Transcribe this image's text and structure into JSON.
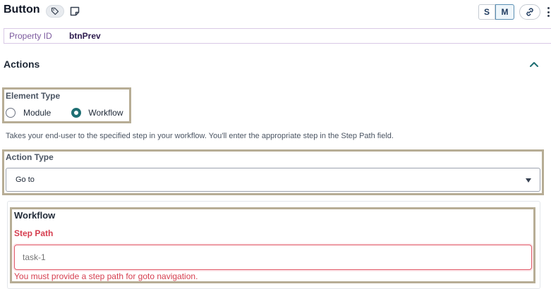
{
  "header": {
    "title": "Button",
    "size_small": "S",
    "size_medium": "M"
  },
  "property": {
    "label": "Property ID",
    "value": "btnPrev"
  },
  "actions": {
    "title": "Actions"
  },
  "element_type": {
    "label": "Element Type",
    "options": [
      {
        "label": "Module",
        "checked": false
      },
      {
        "label": "Workflow",
        "checked": true
      }
    ],
    "help": "Takes your end-user to the specified step in your workflow. You'll enter the appropriate step in the Step Path field."
  },
  "action_type": {
    "label": "Action Type",
    "selected": "Go to"
  },
  "workflow": {
    "title": "Workflow",
    "step_path_label": "Step Path",
    "step_path_placeholder": "task-1",
    "step_path_value": "",
    "error": "You must provide a step path for goto navigation."
  },
  "colors": {
    "accent": "#1f6f73",
    "error": "#d63e4f",
    "highlight_box": "#b7ad95",
    "property_border": "#d9c9e6"
  },
  "icons": [
    "tag-icon",
    "note-icon",
    "link-icon",
    "kebab-menu-icon",
    "chevron-up-icon",
    "caret-down-icon"
  ]
}
